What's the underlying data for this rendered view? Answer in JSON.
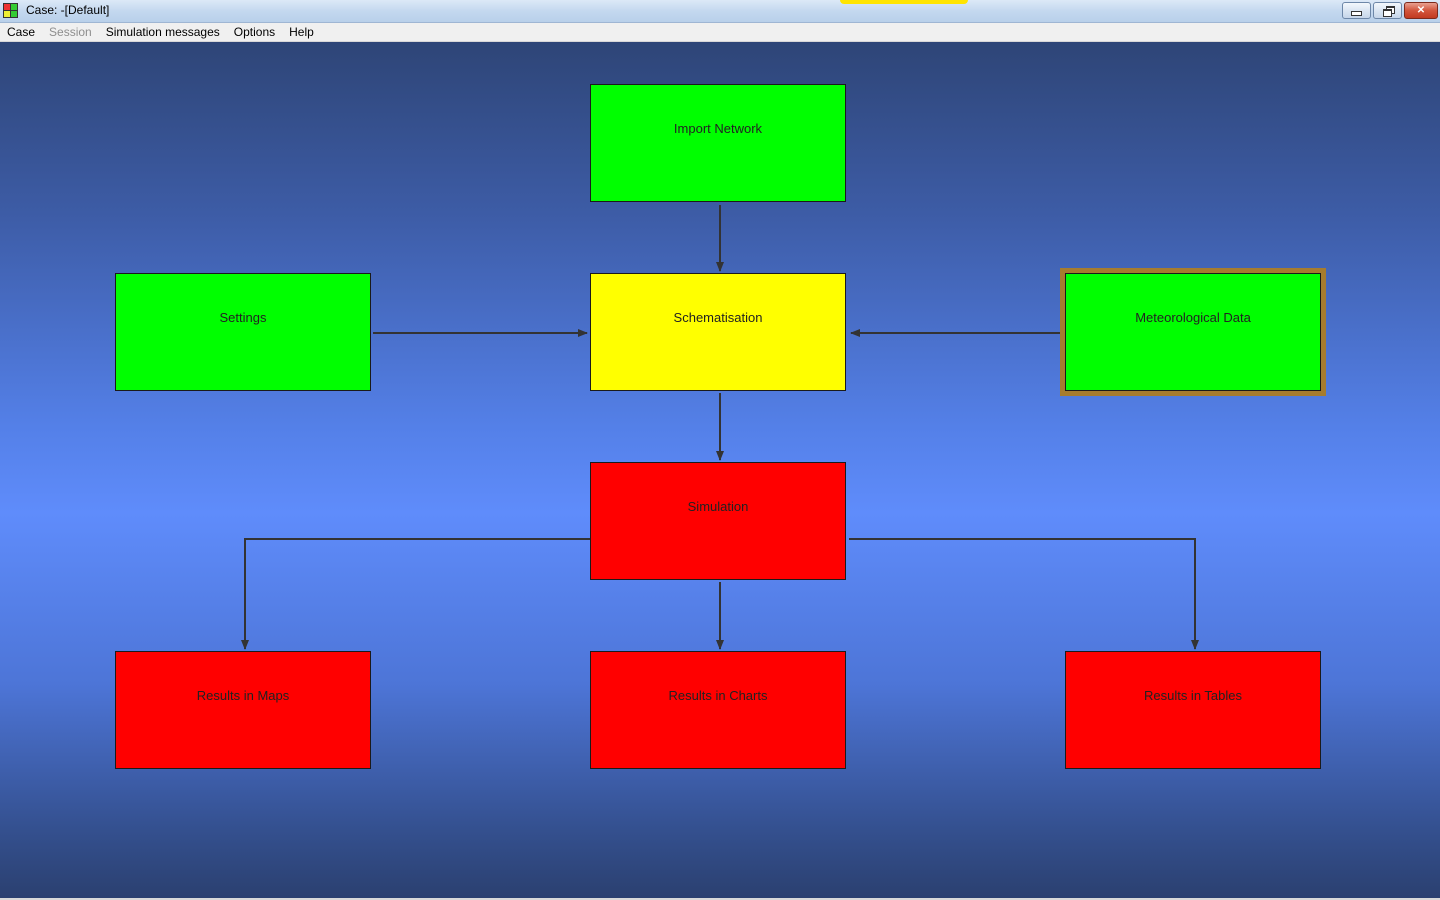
{
  "window": {
    "title": "Case: -[Default]"
  },
  "menu": {
    "items": [
      {
        "label": "Case",
        "enabled": true
      },
      {
        "label": "Session",
        "enabled": false
      },
      {
        "label": "Simulation messages",
        "enabled": true
      },
      {
        "label": "Options",
        "enabled": true
      },
      {
        "label": "Help",
        "enabled": true
      }
    ]
  },
  "workflow": {
    "nodes": {
      "import_network": {
        "label": "Import Network",
        "status_color": "#00ff00"
      },
      "settings": {
        "label": "Settings",
        "status_color": "#00ff00"
      },
      "schematisation": {
        "label": "Schematisation",
        "status_color": "#ffff00"
      },
      "meteorological_data": {
        "label": "Meteorological Data",
        "status_color": "#00ff00",
        "selected": true
      },
      "simulation": {
        "label": "Simulation",
        "status_color": "#ff0000"
      },
      "results_maps": {
        "label": "Results in Maps",
        "status_color": "#ff0000"
      },
      "results_charts": {
        "label": "Results in Charts",
        "status_color": "#ff0000"
      },
      "results_tables": {
        "label": "Results in Tables",
        "status_color": "#ff0000"
      }
    },
    "edges": [
      {
        "from": "import_network",
        "to": "schematisation"
      },
      {
        "from": "settings",
        "to": "schematisation"
      },
      {
        "from": "meteorological_data",
        "to": "schematisation"
      },
      {
        "from": "schematisation",
        "to": "simulation"
      },
      {
        "from": "simulation",
        "to": "results_maps"
      },
      {
        "from": "simulation",
        "to": "results_charts"
      },
      {
        "from": "simulation",
        "to": "results_tables"
      }
    ]
  },
  "colors": {
    "complete": "#00ff00",
    "in_progress": "#ffff00",
    "not_started": "#ff0000",
    "selection_border": "#a67c2e",
    "connector": "#333333"
  }
}
